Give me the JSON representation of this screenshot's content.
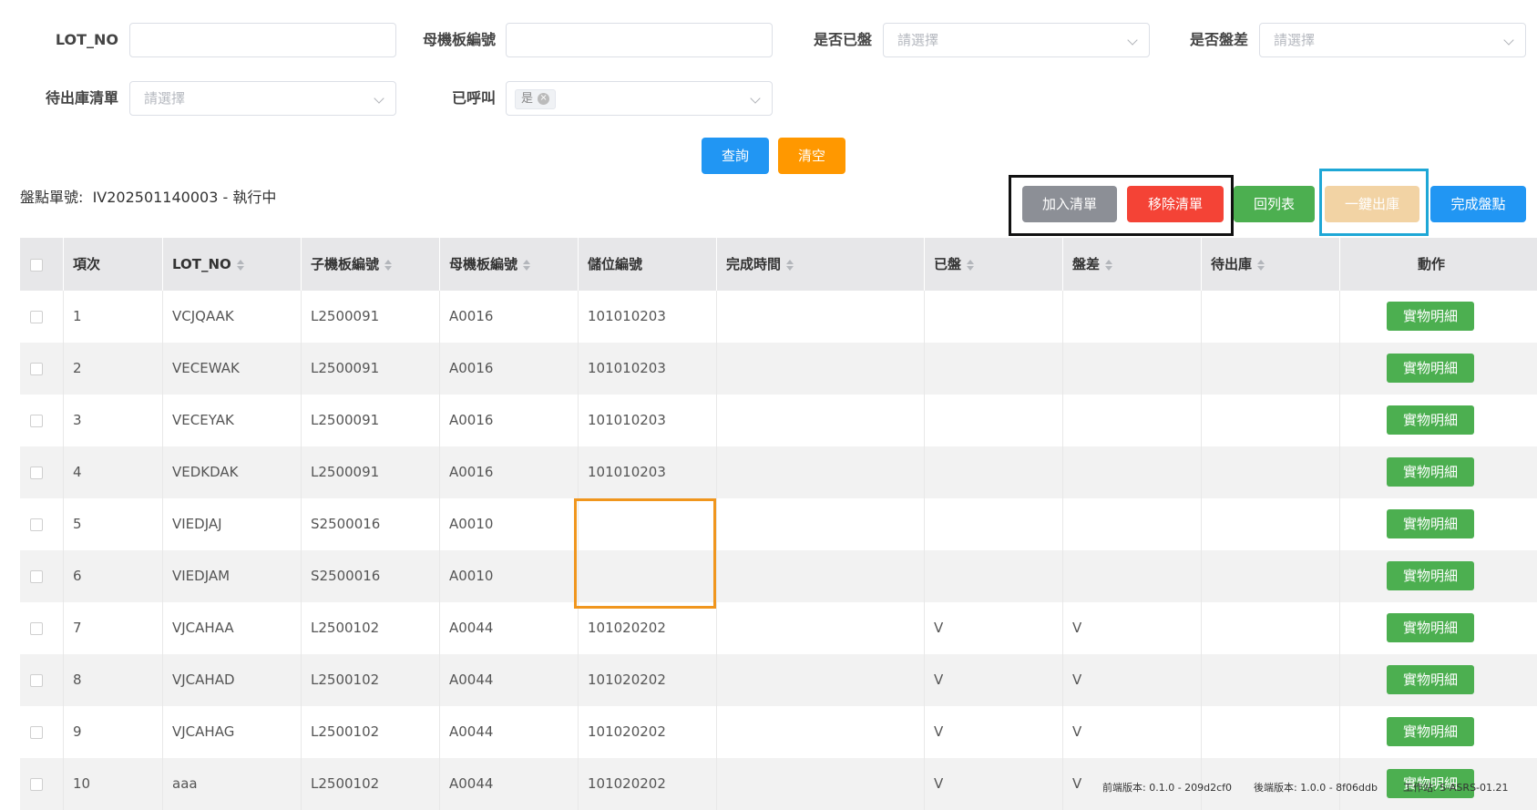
{
  "filters": {
    "lot_no_label": "LOT_NO",
    "parent_board_label": "母機板編號",
    "counted_label": "是否已盤",
    "counted_placeholder": "請選擇",
    "diff_label": "是否盤差",
    "diff_placeholder": "請選擇",
    "pending_list_label": "待出庫清單",
    "pending_list_placeholder": "請選擇",
    "called_label": "已呼叫",
    "called_tag": "是"
  },
  "actions": {
    "query": "查詢",
    "clear": "清空",
    "add_list": "加入清單",
    "remove_list": "移除清單",
    "back_list": "回列表",
    "one_click_out": "一鍵出庫",
    "finish_count": "完成盤點"
  },
  "order_info": "盤點單號:  IV202501140003 - 執行中",
  "table": {
    "headers": {
      "item": "項次",
      "lot_no": "LOT_NO",
      "child_board": "子機板編號",
      "parent_board": "母機板編號",
      "location": "儲位編號",
      "done_time": "完成時間",
      "counted": "已盤",
      "diff": "盤差",
      "pending": "待出庫",
      "action": "動作"
    },
    "action_label": "實物明細",
    "rows": [
      {
        "item": "1",
        "lot": "VCJQAAK",
        "child": "L2500091",
        "parent": "A0016",
        "loc": "101010203",
        "time": "",
        "counted": "",
        "diff": "",
        "pending": ""
      },
      {
        "item": "2",
        "lot": "VECEWAK",
        "child": "L2500091",
        "parent": "A0016",
        "loc": "101010203",
        "time": "",
        "counted": "",
        "diff": "",
        "pending": ""
      },
      {
        "item": "3",
        "lot": "VECEYAK",
        "child": "L2500091",
        "parent": "A0016",
        "loc": "101010203",
        "time": "",
        "counted": "",
        "diff": "",
        "pending": ""
      },
      {
        "item": "4",
        "lot": "VEDKDAK",
        "child": "L2500091",
        "parent": "A0016",
        "loc": "101010203",
        "time": "",
        "counted": "",
        "diff": "",
        "pending": ""
      },
      {
        "item": "5",
        "lot": "VIEDJAJ",
        "child": "S2500016",
        "parent": "A0010",
        "loc": "",
        "time": "",
        "counted": "",
        "diff": "",
        "pending": ""
      },
      {
        "item": "6",
        "lot": "VIEDJAM",
        "child": "S2500016",
        "parent": "A0010",
        "loc": "",
        "time": "",
        "counted": "",
        "diff": "",
        "pending": ""
      },
      {
        "item": "7",
        "lot": "VJCAHAA",
        "child": "L2500102",
        "parent": "A0044",
        "loc": "101020202",
        "time": "",
        "counted": "V",
        "diff": "V",
        "pending": ""
      },
      {
        "item": "8",
        "lot": "VJCAHAD",
        "child": "L2500102",
        "parent": "A0044",
        "loc": "101020202",
        "time": "",
        "counted": "V",
        "diff": "V",
        "pending": ""
      },
      {
        "item": "9",
        "lot": "VJCAHAG",
        "child": "L2500102",
        "parent": "A0044",
        "loc": "101020202",
        "time": "",
        "counted": "V",
        "diff": "V",
        "pending": ""
      },
      {
        "item": "10",
        "lot": "aaa",
        "child": "L2500102",
        "parent": "A0044",
        "loc": "101020202",
        "time": "",
        "counted": "V",
        "diff": "V",
        "pending": ""
      }
    ]
  },
  "footer": {
    "frontend_version": "前端版本:  0.1.0 - 209d2cf0",
    "backend_version": "後端版本:  1.0.0 - 8f06ddb",
    "station": "工作站:  S-ASRS-01.21"
  },
  "colors": {
    "query_btn": "#2196f3",
    "clear_btn": "#ff9800",
    "add_btn": "#8c8f96",
    "remove_btn": "#f44336",
    "back_btn": "#4caf50",
    "out_btn": "#f2d3a4",
    "finish_btn": "#2196f3",
    "action_btn": "#4caf50"
  }
}
